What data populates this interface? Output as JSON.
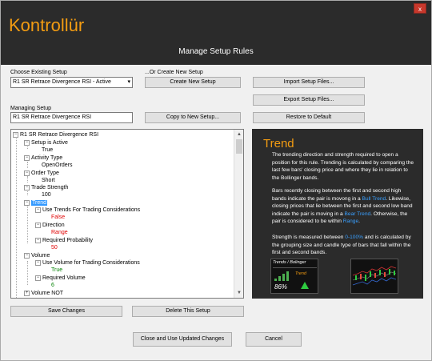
{
  "header": {
    "app_title": "Kontrollür",
    "subtitle": "Manage Setup Rules",
    "close_label": "x"
  },
  "left_form": {
    "choose_label": "Choose Existing Setup",
    "choose_value": "R1 SR Retrace Divergence RSI - Active",
    "managing_label": "Managing Setup",
    "managing_value": "R1 SR Retrace Divergence RSI"
  },
  "middle": {
    "or_create_label": "...Or Create New Setup",
    "create_button": "Create New Setup",
    "copy_button": "Copy to New Setup..."
  },
  "right_buttons": {
    "import": "Import Setup Files...",
    "export": "Export Setup Files...",
    "restore": "Restore to Default"
  },
  "tree": {
    "root": "R1 SR Retrace Divergence RSI",
    "items": [
      {
        "label": "Setup is Active"
      },
      {
        "label": "True"
      },
      {
        "label": "Activity Type"
      },
      {
        "label": "OpenOrders"
      },
      {
        "label": "Order Type"
      },
      {
        "label": "Short"
      },
      {
        "label": "Trade Strength"
      },
      {
        "label": "100"
      },
      {
        "label": "Trend"
      },
      {
        "label": "Use Trends For Trading Considerations"
      },
      {
        "label": "False"
      },
      {
        "label": "Direction"
      },
      {
        "label": "Range"
      },
      {
        "label": "Required Probability"
      },
      {
        "label": "50"
      },
      {
        "label": "Volume"
      },
      {
        "label": "Use Volume for Trading Considerations"
      },
      {
        "label": "True"
      },
      {
        "label": "Required Volume"
      },
      {
        "label": "6"
      },
      {
        "label": "Volume NOT"
      }
    ]
  },
  "info": {
    "title": "Trend",
    "para1": "The trending direction and strength required to open a position for this rule. Trending is calculated by comparing the last few bars' closing price and where they lie in relation to the Bollinger bands.",
    "para2_a": "Bars recently closing between the first and second high bands indicate the pair is movong in a ",
    "para2_hl1": "Bull Trend",
    "para2_b": ". Likewise, closing prices that lie between the first and second low band indicate the pair is moving in a ",
    "para2_hl2": "Bear Trend",
    "para2_c": ". Otherwise, the pair is considered to be within ",
    "para2_hl3": "Range",
    "para2_d": ".",
    "para3_a": "Strength is measured between ",
    "para3_hl": "0-100%",
    "para3_b": " and is calculated by the grouping size and candle type of bars that fall within the first and second bands.",
    "thumb_title": "Trends / Bolinger",
    "thumb_trend": "Trend",
    "thumb_pct": "86%"
  },
  "bottom": {
    "save": "Save Changes",
    "delete": "Delete This Setup",
    "close_use": "Close and Use Updated Changes",
    "cancel": "Cancel"
  },
  "colors": {
    "accent": "#f39c12",
    "header_bg": "#2b2b2b",
    "highlight": "#3aa0ff",
    "selected": "#3399ff"
  }
}
